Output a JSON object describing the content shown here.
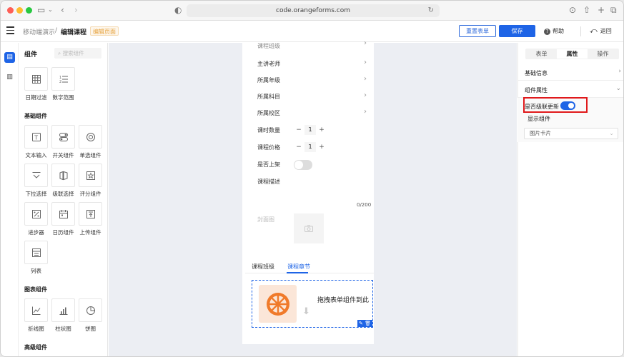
{
  "browser": {
    "url": "code.orangeforms.com"
  },
  "header": {
    "breadcrumb_parent": "移动端演示",
    "breadcrumb_sep": "/",
    "breadcrumb_current": "编辑课程",
    "tag": "编辑页面",
    "reset_label": "重置表单",
    "save_label": "保存",
    "help_label": "帮助",
    "back_label": "返回"
  },
  "panel": {
    "title": "组件",
    "search_placeholder": "搜索组件",
    "top_items": [
      {
        "label": "日期过滤",
        "icon": "calendar-grid-icon"
      },
      {
        "label": "数字范围",
        "icon": "number-list-icon"
      }
    ],
    "basic_title": "基础组件",
    "basic_items": [
      {
        "label": "文本输入",
        "icon": "text-input-icon"
      },
      {
        "label": "开关组件",
        "icon": "switch-icon"
      },
      {
        "label": "单选组件",
        "icon": "radio-icon"
      },
      {
        "label": "下拉选择",
        "icon": "dropdown-icon"
      },
      {
        "label": "级联选择",
        "icon": "cascade-icon"
      },
      {
        "label": "评分组件",
        "icon": "star-icon"
      },
      {
        "label": "进步器",
        "icon": "stepper-icon"
      },
      {
        "label": "日历组件",
        "icon": "calendar-icon"
      },
      {
        "label": "上传组件",
        "icon": "upload-icon"
      },
      {
        "label": "列表",
        "icon": "list-icon"
      }
    ],
    "chart_title": "图表组件",
    "chart_items": [
      {
        "label": "折线图",
        "icon": "line-chart-icon"
      },
      {
        "label": "柱状图",
        "icon": "bar-chart-icon"
      },
      {
        "label": "饼图",
        "icon": "pie-chart-icon"
      }
    ],
    "advanced_title": "高级组件"
  },
  "form": {
    "partial_top": "课程班级",
    "rows": [
      {
        "label": "主讲老师"
      },
      {
        "label": "所属年级"
      },
      {
        "label": "所属科目"
      },
      {
        "label": "所属校区"
      }
    ],
    "hours_label": "课时数量",
    "hours_value": "1",
    "price_label": "课程价格",
    "price_value": "1",
    "shelf_label": "是否上架",
    "desc_label": "课程描述",
    "desc_counter": "0/200",
    "cover_label": "封面图",
    "tabs": [
      "课程班级",
      "课程章节"
    ],
    "drop_text": "拖拽表单组件到此"
  },
  "props": {
    "tabs": [
      "表单",
      "属性",
      "操作"
    ],
    "basic_info": "基础信息",
    "component_props": "组件属性",
    "cascade_label": "是否级联更新",
    "cascade_on": true,
    "display_label": "显示组件",
    "display_value": "图片卡片"
  },
  "colors": {
    "primary": "#1e64e6",
    "highlight": "#e0191b",
    "tag": "#e6a23c"
  }
}
